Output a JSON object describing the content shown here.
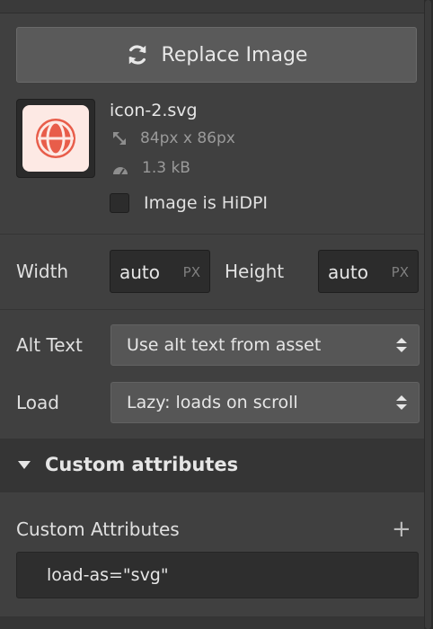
{
  "image": {
    "replace_label": "Replace Image",
    "filename": "icon-2.svg",
    "dimensions": "84px x 86px",
    "size": "1.3 kB",
    "hidpi_label": "Image is HiDPI",
    "hidpi_checked": false
  },
  "size_fields": {
    "width_label": "Width",
    "width_value": "auto",
    "width_unit": "PX",
    "height_label": "Height",
    "height_value": "auto",
    "height_unit": "PX"
  },
  "alt_text": {
    "label": "Alt Text",
    "value": "Use alt text from asset"
  },
  "load": {
    "label": "Load",
    "value": "Lazy: loads on scroll"
  },
  "custom_attributes_section": {
    "title": "Custom attributes",
    "list_label": "Custom Attributes",
    "add_symbol": "+",
    "items": [
      "load-as=\"svg\""
    ]
  },
  "colors": {
    "panel_bg": "#404040",
    "button_bg": "#5a5a5a",
    "input_bg": "#2c2c2c",
    "icon_red": "#e85d4a",
    "thumb_bg": "#fde9e4"
  },
  "icons": {
    "replace": "refresh-icon",
    "dimensions": "resize-arrows-icon",
    "size": "gauge-icon",
    "section_toggle": "caret-down-icon",
    "select_arrows": "up-down-arrows-icon",
    "thumbnail": "globe-icon"
  }
}
